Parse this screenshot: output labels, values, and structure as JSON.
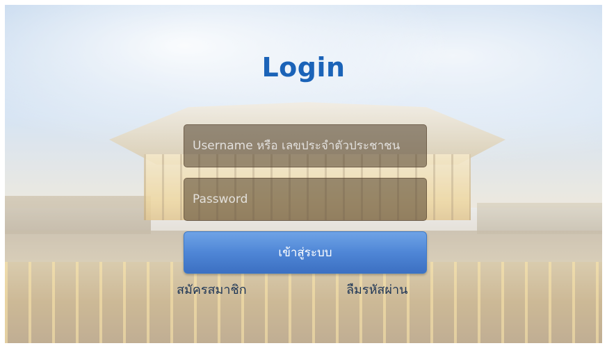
{
  "title": "Login",
  "username": {
    "placeholder": "Username หรือ เลขประจำตัวประชาชน",
    "value": ""
  },
  "password": {
    "placeholder": "Password",
    "value": ""
  },
  "submit_label": "เข้าสู่ระบบ",
  "links": {
    "register": "สมัครสมาชิก",
    "forgot_password": "ลืมรหัสผ่าน"
  },
  "colors": {
    "title": "#1b63b8",
    "button": "#4f86d6",
    "field_bg": "#50402c"
  }
}
